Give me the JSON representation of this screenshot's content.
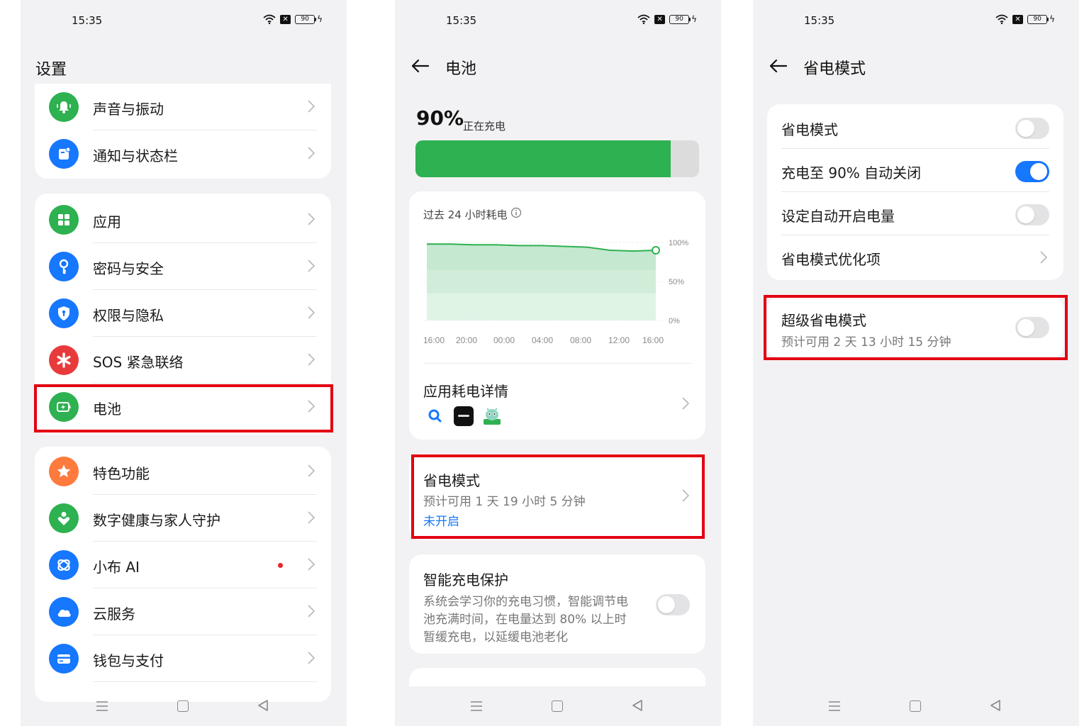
{
  "status_bar": {
    "time": "15:35",
    "battery": "90"
  },
  "settings": {
    "title": "设置",
    "groups": [
      {
        "items": [
          {
            "label": "声音与振动",
            "icon": "bell-icon",
            "color": "#2eb150"
          },
          {
            "label": "通知与状态栏",
            "icon": "notification-icon",
            "color": "#1677ff"
          }
        ]
      },
      {
        "items": [
          {
            "label": "应用",
            "icon": "apps-grid-icon",
            "color": "#2eb150"
          },
          {
            "label": "密码与安全",
            "icon": "key-icon",
            "color": "#1677ff"
          },
          {
            "label": "权限与隐私",
            "icon": "shield-icon",
            "color": "#1677ff"
          },
          {
            "label": "SOS 紧急联络",
            "icon": "sos-icon",
            "color": "#e83a3a"
          },
          {
            "label": "电池",
            "icon": "battery-icon",
            "color": "#2eb150"
          }
        ]
      },
      {
        "items": [
          {
            "label": "特色功能",
            "icon": "star-icon",
            "color": "#ff7a3d"
          },
          {
            "label": "数字健康与家人守护",
            "icon": "health-icon",
            "color": "#2eb150"
          },
          {
            "label": "小布 AI",
            "icon": "ai-icon",
            "color": "#1677ff"
          },
          {
            "label": "云服务",
            "icon": "cloud-icon",
            "color": "#1677ff"
          },
          {
            "label": "钱包与支付",
            "icon": "wallet-icon",
            "color": "#1677ff"
          }
        ]
      }
    ]
  },
  "battery_page": {
    "title": "电池",
    "percent": "90%",
    "percent_value": 0.9,
    "status": "正在充电",
    "usage_title": "过去 24 小时耗电",
    "app_usage_title": "应用耗电详情",
    "power_saving": {
      "title": "省电模式",
      "desc": "预计可用 1 天 19 小时 5 分钟",
      "status": "未开启"
    },
    "smart_charging": {
      "title": "智能充电保护",
      "desc_lines": [
        "系统会学习你的充电习惯，智能调节电",
        "池充满时间，在电量达到 80% 以上时",
        "暂缓充电，以延缓电池老化"
      ],
      "enabled": false
    }
  },
  "chart_data": {
    "type": "area",
    "title": "过去 24 小时耗电",
    "x": [
      "16:00",
      "20:00",
      "00:00",
      "04:00",
      "08:00",
      "12:00",
      "16:00"
    ],
    "y": [
      98,
      98,
      97,
      97,
      96,
      96,
      95,
      94,
      90,
      89,
      90
    ],
    "x_positions": [
      0,
      1,
      2,
      3,
      4,
      5,
      6,
      7,
      8,
      9,
      10
    ],
    "y_ticks": [
      "100%",
      "50%",
      "0%"
    ],
    "ylim": [
      0,
      100
    ]
  },
  "power_saving_page": {
    "title": "省电模式",
    "items": [
      {
        "label": "省电模式",
        "type": "toggle",
        "on": false
      },
      {
        "label": "充电至 90% 自动关闭",
        "type": "toggle",
        "on": true
      },
      {
        "label": "设定自动开启电量",
        "type": "toggle",
        "on": false
      },
      {
        "label": "省电模式优化项",
        "type": "link"
      }
    ],
    "super": {
      "title": "超级省电模式",
      "desc": "预计可用 2 天 13 小时 15 分钟",
      "on": false
    }
  },
  "colors": {
    "accent": "#1677ff",
    "green": "#2eb150",
    "highlight": "#e30012"
  }
}
